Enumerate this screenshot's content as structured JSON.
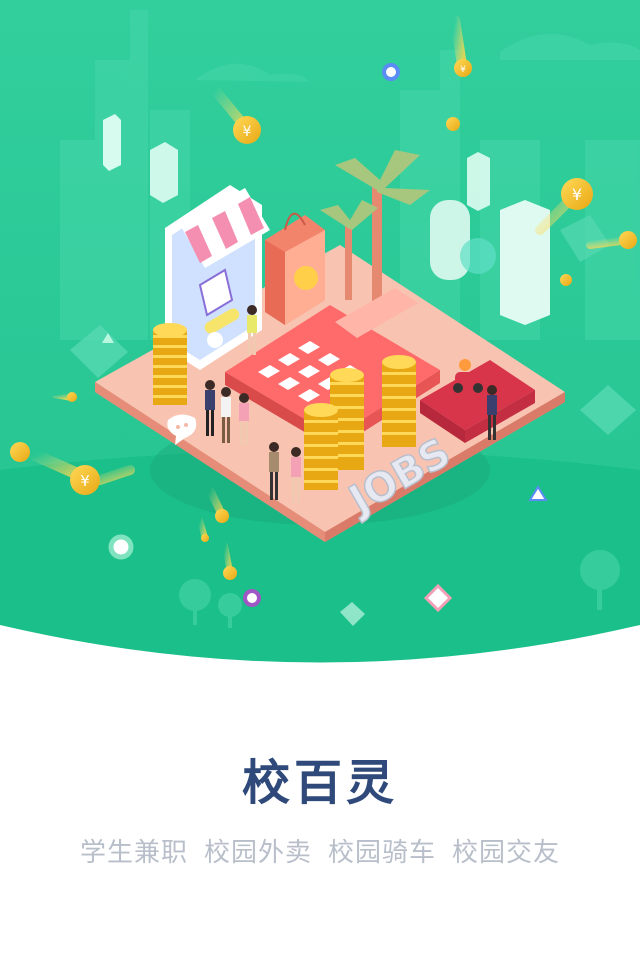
{
  "app": {
    "title": "校百灵",
    "features": [
      "学生兼职",
      "校园外卖",
      "校园骑车",
      "校园交友"
    ]
  },
  "illustration": {
    "jobs_text": "JOBS",
    "icon_names": [
      "shop-icon",
      "shopping-bag-icon",
      "calculator-icon",
      "coin-icon",
      "wallet-icon",
      "chat-bubble-icon",
      "palm-tree-icon"
    ]
  },
  "colors": {
    "green_bg": "#29c997",
    "green_light": "#3dd3a5",
    "platform": "#f4b9a4",
    "title": "#2f4a7a",
    "tagline": "#b8bfca",
    "coin": "#f7c93a"
  }
}
